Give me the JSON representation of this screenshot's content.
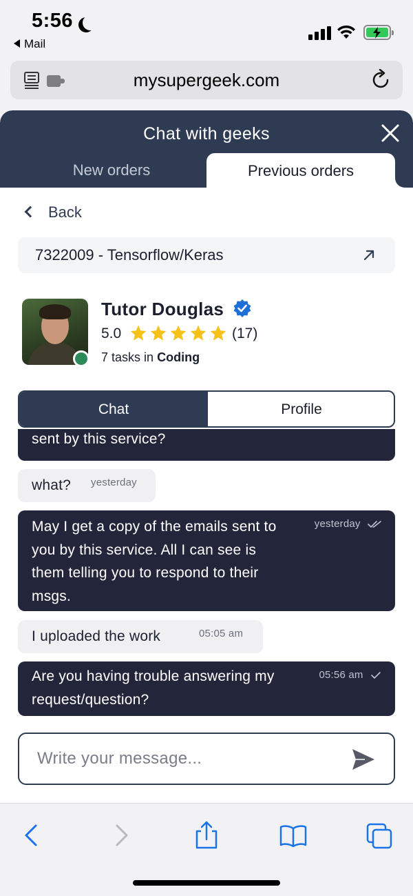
{
  "status_bar": {
    "time": "5:56",
    "back_app": "Mail"
  },
  "browser": {
    "url": "mysupergeek.com"
  },
  "header": {
    "title": "Chat with geeks",
    "tabs": [
      {
        "label": "New orders",
        "active": false
      },
      {
        "label": "Previous orders",
        "active": true
      }
    ]
  },
  "back_label": "Back",
  "order": {
    "title": "7322009 - Tensorflow/Keras"
  },
  "tutor": {
    "name": "Tutor Douglas",
    "rating": "5.0",
    "stars": 5,
    "reviews": "(17)",
    "tasks_count": "7",
    "tasks_text": "tasks in",
    "category": "Coding",
    "online": true
  },
  "segments": {
    "chat": "Chat",
    "profile": "Profile"
  },
  "messages": [
    {
      "from": "me",
      "text": "sent by this service?",
      "time": "",
      "status": ""
    },
    {
      "from": "tutor",
      "text": "what?",
      "time": "yesterday"
    },
    {
      "from": "me",
      "text": "May I get a copy of the emails sent to you by this service. All I can see is them telling you to respond to their msgs.",
      "time": "yesterday",
      "status": "read"
    },
    {
      "from": "tutor",
      "text": "I uploaded the work",
      "time": "05:05 am"
    },
    {
      "from": "me",
      "text": "Are you having trouble answering my request/question?",
      "time": "05:56 am",
      "status": "sent"
    }
  ],
  "composer": {
    "placeholder": "Write your message..."
  },
  "colors": {
    "primary": "#2f3b52",
    "outgoing_bubble": "#23263a",
    "incoming_bubble": "#f0f0f2",
    "online": "#2b8a57",
    "star": "#f6c21a",
    "verified": "#1d6fd6",
    "ios_blue": "#1a73e8"
  }
}
